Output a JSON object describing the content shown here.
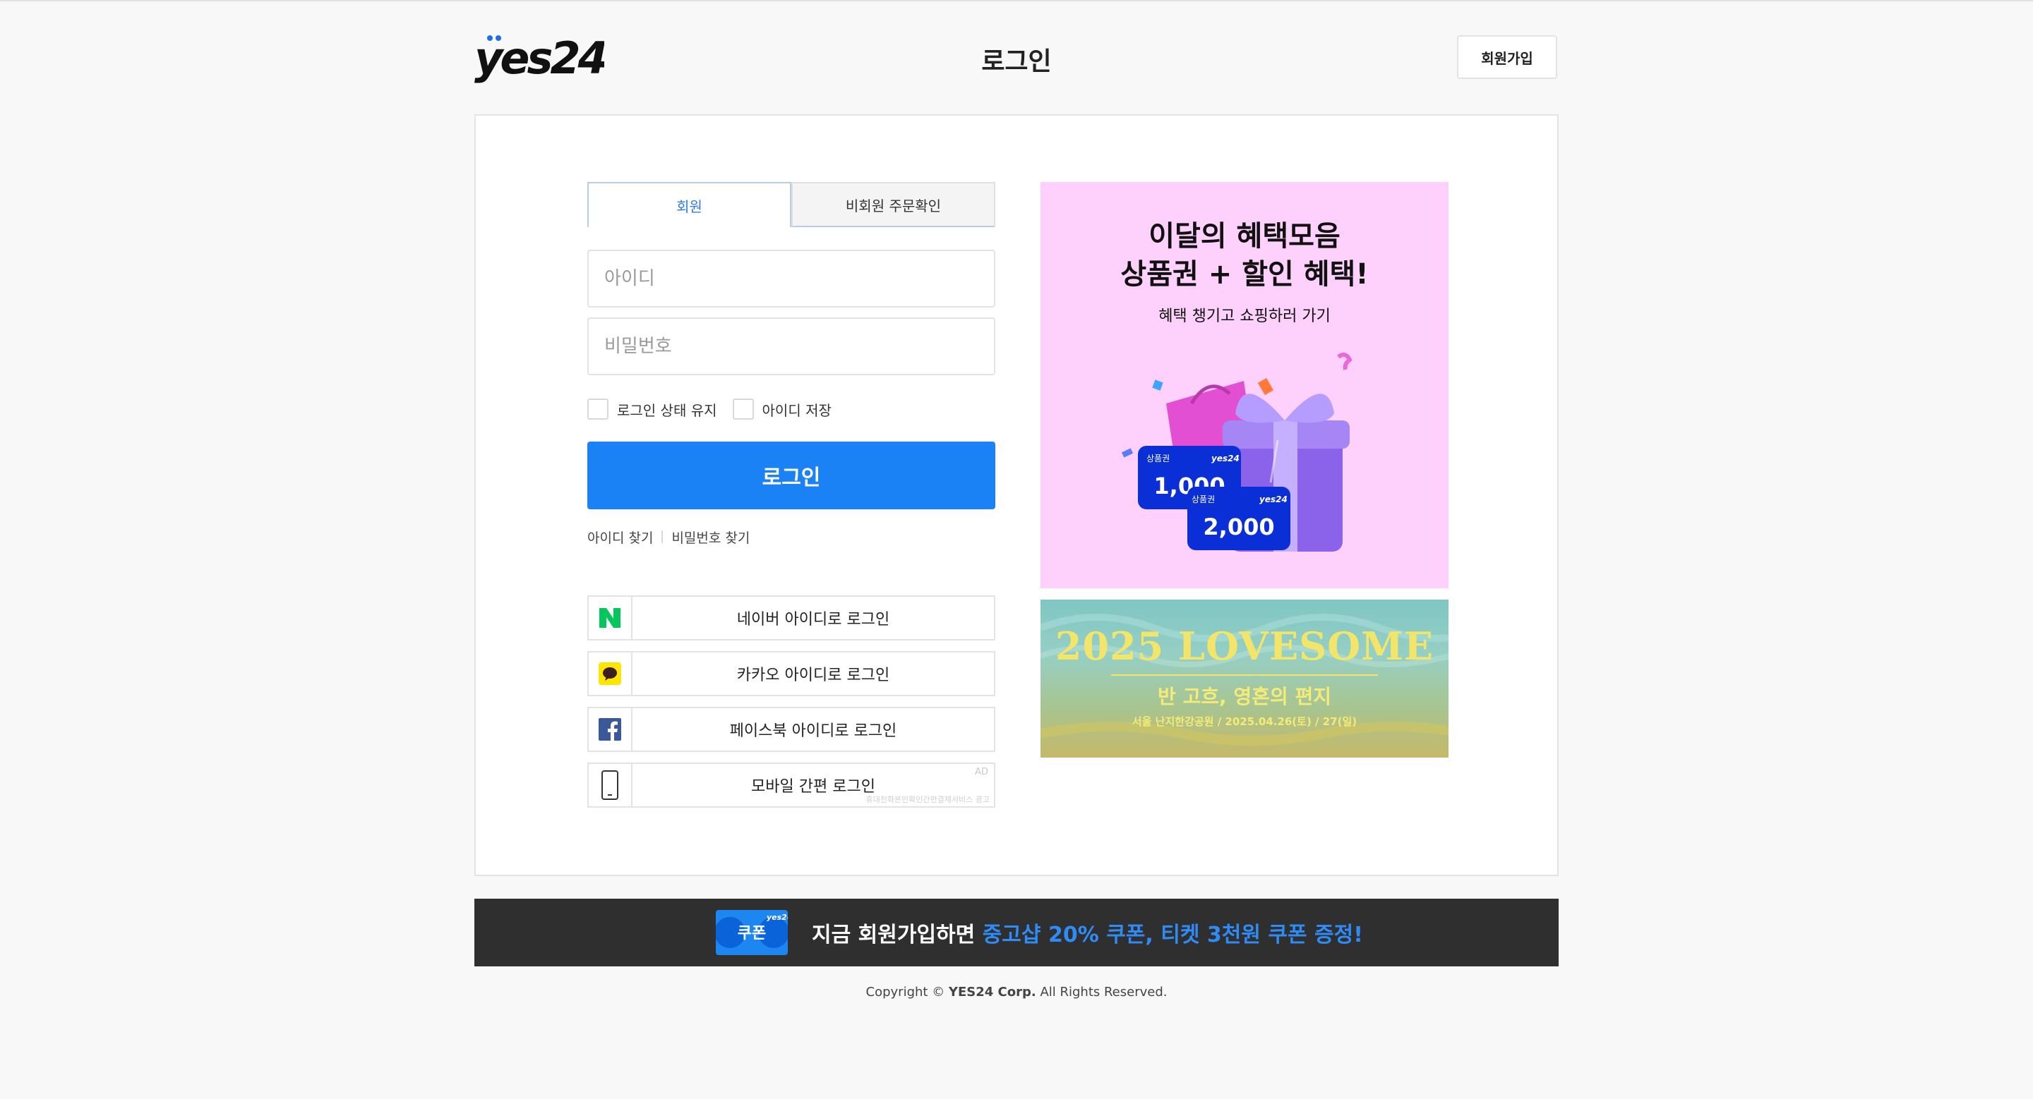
{
  "header": {
    "logo_text": "yes24",
    "title": "로그인",
    "signup_label": "회원가입"
  },
  "tabs": [
    {
      "label": "회원"
    },
    {
      "label": "비회원 주문확인"
    }
  ],
  "form": {
    "id_placeholder": "아이디",
    "password_placeholder": "비밀번호",
    "keep_login_label": "로그인 상태 유지",
    "save_id_label": "아이디 저장",
    "login_button": "로그인",
    "find_id": "아이디 찾기",
    "find_password": "비밀번호 찾기"
  },
  "social": {
    "naver": "네이버 아이디로 로그인",
    "kakao": "카카오 아이디로 로그인",
    "facebook": "페이스북 아이디로 로그인",
    "mobile": "모바일 간편 로그인",
    "ad_tag": "AD",
    "ad_note": "휴대전화본인확인간편결제서비스 광고"
  },
  "banner1": {
    "title1": "이달의 혜택모음",
    "title2": "상품권 + 할인 혜택!",
    "subtitle": "혜택 챙기고 쇼핑하러 가기",
    "voucher_label": "상품권",
    "voucher1": "1,000",
    "voucher2": "2,000",
    "brand": "yes24"
  },
  "banner2": {
    "title": "2025 LOVESOME",
    "subtitle": "반 고흐, 영혼의 편지",
    "detail": "서울 난지한강공원 / 2025.04.26(토) / 27(일)"
  },
  "promo": {
    "coupon_label": "쿠폰",
    "coupon_brand": "yes24",
    "text_white": "지금 회원가입하면 ",
    "text_blue": "중고샵 20% 쿠폰, 티켓 3천원 쿠폰 증정!"
  },
  "footer": {
    "copyright_prefix": "Copyright © ",
    "copyright_brand": "YES24 Corp.",
    "copyright_suffix": " All Rights Reserved."
  },
  "colors": {
    "primary": "#1a82f4",
    "naver": "#03c75a",
    "kakao": "#fee500",
    "facebook": "#3b5998",
    "banner_pink": "#fdd1fb"
  }
}
